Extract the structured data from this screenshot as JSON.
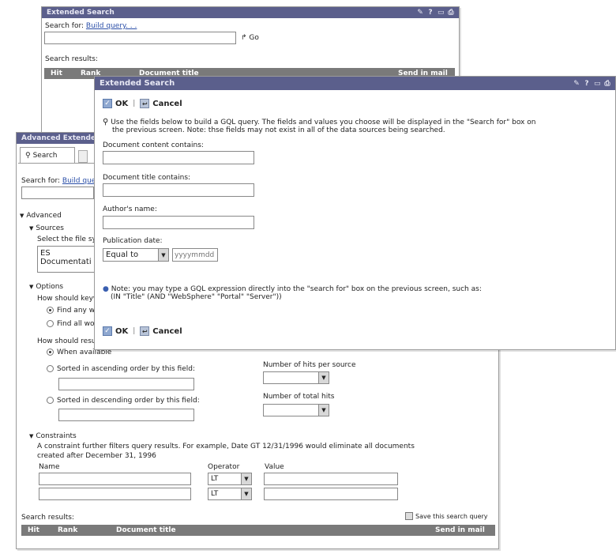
{
  "back_window": {
    "title": "Extended Search",
    "search_for_label": "Search for:",
    "build_query_link": "Build query. . .",
    "go_label": "Go",
    "search_results_label": "Search results:",
    "columns": [
      "Hit",
      "Rank",
      "Document title",
      "Send in mail"
    ]
  },
  "mid_window": {
    "title": "Advanced Extended Search",
    "tab_search": "Search",
    "search_for_label": "Search for:",
    "build_query_link": "Build query",
    "advanced_label": "Advanced",
    "sources_label": "Sources",
    "sources_prompt": "Select the file sy",
    "source_value": "ES Documentati",
    "options_label": "Options",
    "keywords_prompt": "How should keyw",
    "find_any": "Find any w",
    "find_all": "Find all wo",
    "results_prompt": "How should resu",
    "when_available": "When available",
    "sort_asc": "Sorted in ascending order by this field:",
    "sort_desc": "Sorted in descending order by this field:",
    "hits_per_source": "Number of hits per source",
    "total_hits": "Number of total hits",
    "constraints_label": "Constraints",
    "constraints_text_1": "A constraint further filters query results. For example, Date GT 12/31/1996 would eliminate all documents",
    "constraints_text_2": "created after December 31, 1996",
    "name_header": "Name",
    "operator_header": "Operator",
    "value_header": "Value",
    "operator_values": [
      "LT",
      "LT"
    ],
    "search_results_label": "Search results:",
    "save_query_label": "Save this search query",
    "columns": [
      "Hit",
      "Rank",
      "Document title",
      "Send in mail"
    ]
  },
  "front_window": {
    "title": "Extended Search",
    "ok_label": "OK",
    "cancel_label": "Cancel",
    "info_line_1": "Use the fields below to build a GQL query.  The fields and values you choose will be displayed in the \"Search for\" box on",
    "info_line_2": "the previous screen.  Note: thse fields may not exist in all of the data sources being searched.",
    "content_label": "Document content contains:",
    "title_label": "Document title contains:",
    "author_label": "Author's name:",
    "pubdate_label": "Publication date:",
    "pubdate_operator": "Equal to",
    "pubdate_placeholder": "yyyymmdd",
    "note_line_1": "Note: you may type a GQL expression directly into the \"search for\" box on the previous screen, such as:",
    "note_line_2": "(IN \"Title\" (AND \"WebSphere\" \"Portal\" \"Server\"))"
  },
  "icons": [
    "pencil-icon",
    "help-icon",
    "minimize-icon",
    "print-icon"
  ]
}
